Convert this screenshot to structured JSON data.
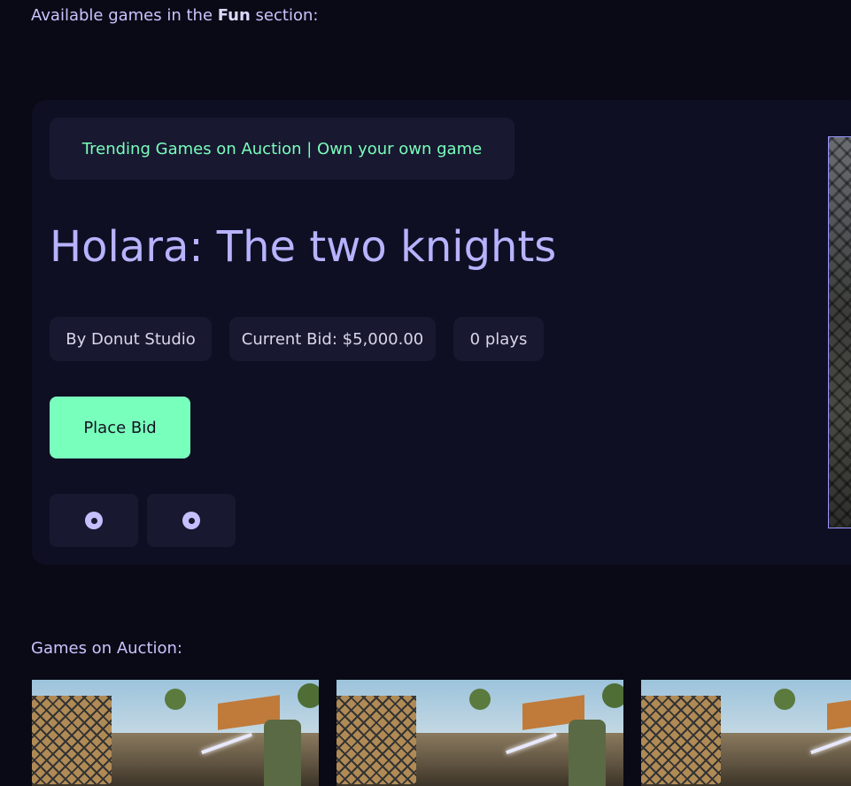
{
  "intro": {
    "prefix": "Available games in the",
    "section": "Fun",
    "suffix": "section:"
  },
  "hero": {
    "tagline": "Trending Games on Auction | Own your own game",
    "title": "Holara: The two knights",
    "studio": "By Donut Studio",
    "current_bid": "Current Bid: $5,000.00",
    "plays": "0 plays",
    "place_bid_label": "Place Bid",
    "carousel_dots": [
      "dot-1",
      "dot-2"
    ]
  },
  "auction_section": {
    "label": "Games on Auction:",
    "thumbnails": [
      "game-thumb-1",
      "game-thumb-2",
      "game-thumb-3"
    ]
  },
  "colors": {
    "background": "#0a0a16",
    "card": "#0f0f24",
    "pill": "#181830",
    "accent": "#79ffbc",
    "title_text": "#b7b3ff"
  }
}
